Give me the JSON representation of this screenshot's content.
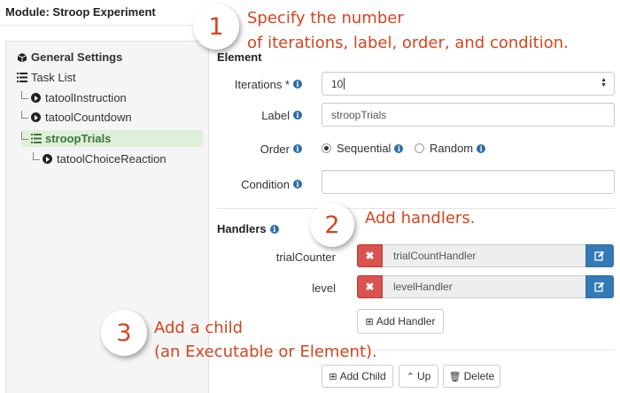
{
  "module": {
    "title": "Module: Stroop Experiment"
  },
  "tree": {
    "general_settings": "General Settings",
    "task_list": "Task List",
    "items": [
      {
        "label": "tatoolInstruction",
        "icon": "play-circle-icon"
      },
      {
        "label": "tatoolCountdown",
        "icon": "play-circle-icon"
      },
      {
        "label": "stroopTrials",
        "icon": "list-icon",
        "selected": true
      },
      {
        "label": "tatoolChoiceReaction",
        "icon": "play-circle-icon"
      }
    ]
  },
  "element": {
    "heading": "Element",
    "iterations_label": "Iterations *",
    "iterations_value": "10",
    "label_label": "Label",
    "label_value": "stroopTrials",
    "order_label": "Order",
    "order_options": [
      "Sequential",
      "Random"
    ],
    "order_selected": "Sequential",
    "condition_label": "Condition",
    "condition_value": ""
  },
  "handlers": {
    "heading": "Handlers",
    "rows": [
      {
        "name": "trialCounter",
        "value": "trialCountHandler"
      },
      {
        "name": "level",
        "value": "levelHandler"
      }
    ],
    "add_label": "Add Handler"
  },
  "actions": {
    "add_child": "Add Child",
    "up": "Up",
    "delete": "Delete"
  },
  "annotations": {
    "step1": {
      "number": "1",
      "line1": "Specify the number",
      "line2": "of iterations, label, order, and condition."
    },
    "step2": {
      "number": "2",
      "text": "Add handlers."
    },
    "step3": {
      "number": "3",
      "line1": "Add a child",
      "line2": "(an Executable or Element)."
    }
  },
  "colors": {
    "annotation": "#d2451e",
    "delete_button": "#d9534f",
    "edit_button": "#337ab7",
    "selected_bg": "#dff0d8",
    "info": "#2c6fa8"
  }
}
